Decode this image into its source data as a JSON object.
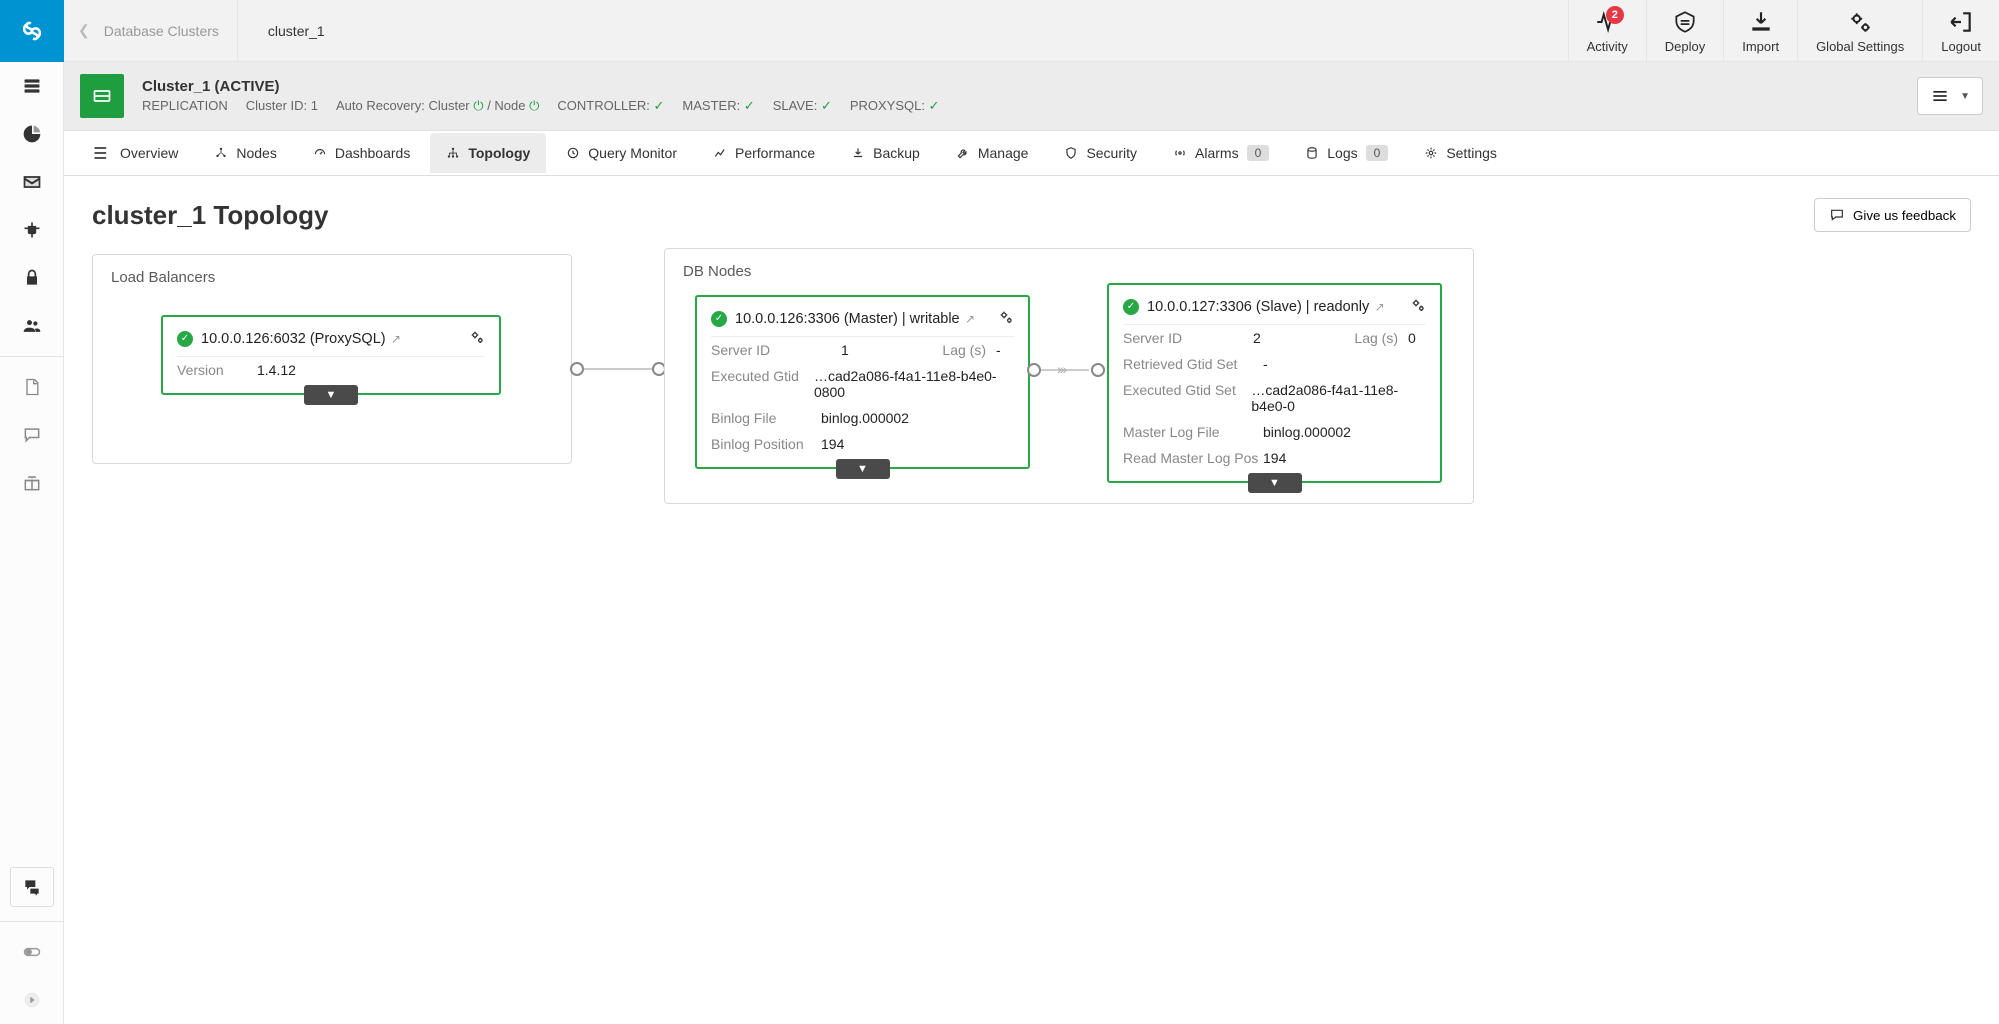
{
  "breadcrumb": {
    "parent": "Database Clusters",
    "current": "cluster_1"
  },
  "top_actions": {
    "activity": "Activity",
    "activity_badge": "2",
    "deploy": "Deploy",
    "import": "Import",
    "global_settings": "Global Settings",
    "logout": "Logout"
  },
  "cluster_strip": {
    "title": "Cluster_1 (ACTIVE)",
    "replication": "REPLICATION",
    "cluster_id_label": "Cluster ID: 1",
    "auto_recovery_label": "Auto Recovery: Cluster",
    "auto_recovery_node": "/ Node",
    "controller": "CONTROLLER:",
    "master": "MASTER:",
    "slave": "SLAVE:",
    "proxysql": "PROXYSQL:"
  },
  "tabs": {
    "overview": "Overview",
    "nodes": "Nodes",
    "dashboards": "Dashboards",
    "topology": "Topology",
    "query_monitor": "Query Monitor",
    "performance": "Performance",
    "backup": "Backup",
    "manage": "Manage",
    "security": "Security",
    "alarms": "Alarms",
    "alarms_count": "0",
    "logs": "Logs",
    "logs_count": "0",
    "settings": "Settings"
  },
  "page": {
    "title": "cluster_1 Topology",
    "feedback_label": "Give us feedback"
  },
  "topology": {
    "lb_panel_title": "Load Balancers",
    "db_panel_title": "DB Nodes",
    "lb_node": {
      "title": "10.0.0.126:6032 (ProxySQL)",
      "rows": [
        {
          "k": "Version",
          "v": "1.4.12"
        }
      ]
    },
    "master_node": {
      "title": "10.0.0.126:3306 (Master) | writable",
      "server_id_k": "Server ID",
      "server_id_v": "1",
      "lag_k": "Lag (s)",
      "lag_v": "-",
      "rows": [
        {
          "k": "Executed Gtid",
          "v": "…cad2a086-f4a1-11e8-b4e0-0800"
        },
        {
          "k": "Binlog File",
          "v": "binlog.000002"
        },
        {
          "k": "Binlog Position",
          "v": "194"
        }
      ]
    },
    "slave_node": {
      "title": "10.0.0.127:3306 (Slave) | readonly",
      "server_id_k": "Server ID",
      "server_id_v": "2",
      "lag_k": "Lag (s)",
      "lag_v": "0",
      "rows": [
        {
          "k": "Retrieved Gtid Set",
          "v": "-"
        },
        {
          "k": "Executed Gtid Set",
          "v": "…cad2a086-f4a1-11e8-b4e0-0"
        },
        {
          "k": "Master Log File",
          "v": "binlog.000002"
        },
        {
          "k": "Read Master Log Pos",
          "v": "194"
        }
      ]
    }
  }
}
